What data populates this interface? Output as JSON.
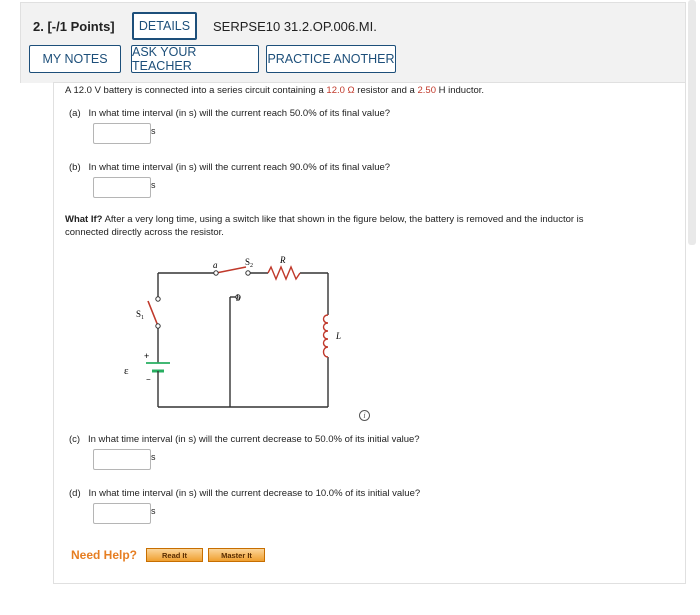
{
  "header": {
    "question_number": "2.",
    "points": "[-/1 Points]",
    "details_label": "DETAILS",
    "problem_code": "SERPSE10 31.2.OP.006.MI.",
    "my_notes_label": "MY NOTES",
    "ask_teacher_label": "ASK YOUR TEACHER",
    "practice_label": "PRACTICE ANOTHER"
  },
  "problem": {
    "intro_prefix": "A 12.0 V battery is connected into a series circuit containing a ",
    "resistance": "12.0 Ω",
    "intro_middle": " resistor and a ",
    "inductance": "2.50",
    "intro_suffix": " H inductor.",
    "accent_color": "#c0392b"
  },
  "parts": [
    {
      "label": "(a)",
      "question": "In what time interval (in s) will the current reach 50.0% of its final value?",
      "unit": "s",
      "value": ""
    },
    {
      "label": "(b)",
      "question": "In what time interval (in s) will the current reach 90.0% of its final value?",
      "unit": "s",
      "value": ""
    },
    {
      "label": "(c)",
      "question": "In what time interval (in s) will the current decrease to 50.0% of its initial value?",
      "unit": "s",
      "value": ""
    },
    {
      "label": "(d)",
      "question": "In what time interval (in s) will the current decrease to 10.0% of its initial value?",
      "unit": "s",
      "value": ""
    }
  ],
  "what_if": {
    "bold": "What If?",
    "line1": " After a very long time, using a switch like that shown in the figure below, the battery is removed and the inductor is",
    "line2": "connected directly across the resistor."
  },
  "figure": {
    "label_a": "a",
    "label_b": "b",
    "label_s2": "S",
    "label_s2_sub": "2",
    "label_s1": "S",
    "label_s1_sub": "1",
    "label_r": "R",
    "label_l": "L",
    "label_emf": "ε",
    "label_plus": "+",
    "label_minus": "−",
    "info_icon": "info-icon",
    "switch_color": "#c0392b",
    "battery_color": "#27ae60",
    "inductor_color": "#c0392b"
  },
  "help": {
    "label": "Need Help?",
    "read_it": "Read It",
    "master_it": "Master It"
  }
}
